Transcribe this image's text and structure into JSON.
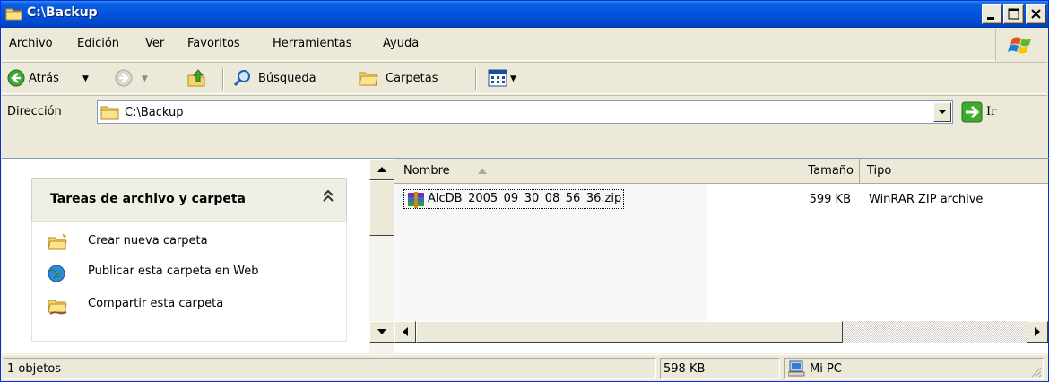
{
  "window": {
    "title": "C:\\Backup"
  },
  "menubar": {
    "items": [
      {
        "label": "Archivo"
      },
      {
        "label": "Edición"
      },
      {
        "label": "Ver"
      },
      {
        "label": "Favoritos"
      },
      {
        "label": "Herramientas"
      },
      {
        "label": "Ayuda"
      }
    ]
  },
  "toolbar": {
    "back_label": "Atrás",
    "search_label": "Búsqueda",
    "folders_label": "Carpetas"
  },
  "address": {
    "label": "Dirección",
    "value": "C:\\Backup",
    "go_label": "Ir"
  },
  "tasks": {
    "title": "Tareas de archivo y carpeta",
    "chevron": "«",
    "items": [
      {
        "label": "Crear nueva carpeta",
        "icon": "new-folder-icon"
      },
      {
        "label": "Publicar esta carpeta en Web",
        "icon": "publish-web-icon"
      },
      {
        "label": "Compartir esta carpeta",
        "icon": "share-folder-icon"
      }
    ]
  },
  "filelist": {
    "columns": [
      {
        "label": "Nombre"
      },
      {
        "label": "Tamaño"
      },
      {
        "label": "Tipo"
      }
    ],
    "rows": [
      {
        "name": "AlcDB_2005_09_30_08_56_36.zip",
        "size": "599 KB",
        "type": "WinRAR ZIP archive",
        "icon": "winrar-zip-icon"
      }
    ]
  },
  "status": {
    "objects": "1 objetos",
    "size": "598 KB",
    "zone": "Mi PC"
  },
  "colors": {
    "title_bar": "#0553dc",
    "chrome": "#ece9d8",
    "border": "#7f9db9"
  }
}
